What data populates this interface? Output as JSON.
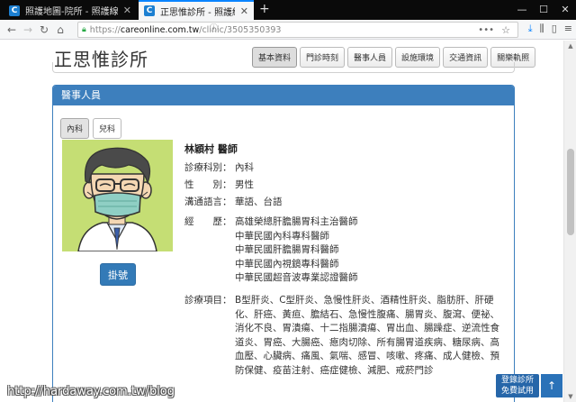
{
  "browser": {
    "tabs": [
      {
        "favicon": "C",
        "title": "照護地圖-院所 - 照護線上",
        "active": false
      },
      {
        "favicon": "C",
        "title": "正思惟診所 - 照護線上",
        "active": true
      }
    ],
    "url": {
      "scheme": "https://",
      "host": "careonline.com.tw",
      "path": "/clinic/3505350393"
    }
  },
  "clinic": {
    "name": "正思惟診所",
    "nav": [
      "基本資料",
      "門診時刻",
      "醫事人員",
      "設施環境",
      "交通資訊",
      "關樂軌照"
    ]
  },
  "panel": {
    "header": "醫事人員",
    "subtabs": [
      "內科",
      "兒科"
    ]
  },
  "doctor": {
    "name": "林穎村 醫師",
    "dept_label": "診療科別：",
    "dept": "內科",
    "gender_label": "性　　別：",
    "gender": "男性",
    "lang_label": "溝通語言：",
    "lang": "華語、台語",
    "exp_label": "經　　歷：",
    "experience": [
      "高雄榮總肝膽腸胃科主治醫師",
      "中華民國內科專科醫師",
      "中華民國肝膽腸胃科醫師",
      "中華民國內視鏡專科醫師",
      "中華民國超音波專業認證醫師"
    ],
    "items_label": "診療項目：",
    "items": "B型肝炎、C型肝炎、急慢性肝炎、酒精性肝炎、脂肪肝、肝硬化、肝癌、黃疸、膽結石、急慢性腹痛、腸胃炎、腹瀉、便祕、消化不良、胃潰瘍、十二指腸潰瘍、胃出血、腸躁症、逆流性食道炎、胃癌、大腸癌、瘜肉切除、所有腸胃道疾病、糖尿病、高血壓、心臟病、痛風、氣喘、感冒、咳嗽、疼痛、成人健檢、預防保健、疫苗注射、癌症健檢、減肥、戒菸門診",
    "book_label": "掛號"
  },
  "overlay": {
    "watermark": "http://hardaway.com.tw/blog",
    "promo_line1": "登錄診所",
    "promo_line2": "免費試用",
    "totop": "↑"
  },
  "icons": {
    "back": "arrow-left-icon",
    "forward": "arrow-right-icon",
    "reload": "reload-icon",
    "home": "home-icon",
    "lock": "lock-icon",
    "download": "download-icon",
    "library": "library-icon",
    "sidebar": "sidebar-icon",
    "menu": "menu-icon"
  },
  "colors": {
    "accent": "#3d7fbd",
    "button": "#337ab7",
    "avatar_bg": "#c5de74"
  }
}
